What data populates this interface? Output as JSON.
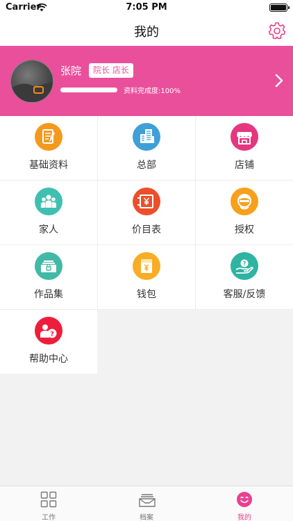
{
  "status_bar": {
    "carrier": "Carrier",
    "time": "7:05 PM"
  },
  "nav": {
    "title": "我的",
    "settings_icon": "gear-icon"
  },
  "profile": {
    "name": "张院",
    "role_badge": "院长 店长",
    "completion_text": "资料完成度:100%",
    "completion_fraction": 1.0,
    "background_color": "#ea4f9c"
  },
  "menu": [
    {
      "label": "基础资料",
      "icon": "document-icon",
      "color": "#f39a1e"
    },
    {
      "label": "总部",
      "icon": "building-icon",
      "color": "#3f9fd8"
    },
    {
      "label": "店铺",
      "icon": "store-icon",
      "color": "#e5377f"
    },
    {
      "label": "家人",
      "icon": "family-icon",
      "color": "#3fbfb0"
    },
    {
      "label": "价目表",
      "icon": "price-list-icon",
      "color": "#ec4f2a"
    },
    {
      "label": "授权",
      "icon": "authorization-icon",
      "color": "#f6a01b"
    },
    {
      "label": "作品集",
      "icon": "portfolio-icon",
      "color": "#41b9a6"
    },
    {
      "label": "钱包",
      "icon": "wallet-icon",
      "color": "#f8ad24"
    },
    {
      "label": "客服/反馈",
      "icon": "customer-service-icon",
      "color": "#2fb3a2"
    },
    {
      "label": "帮助中心",
      "icon": "help-icon",
      "color": "#ee1d3b"
    }
  ],
  "tab_bar": {
    "tabs": [
      {
        "label": "工作",
        "icon": "grid-icon",
        "active": false
      },
      {
        "label": "档案",
        "icon": "archive-icon",
        "active": false
      },
      {
        "label": "我的",
        "icon": "smile-icon",
        "active": true
      }
    ],
    "active_color": "#e8418e"
  }
}
